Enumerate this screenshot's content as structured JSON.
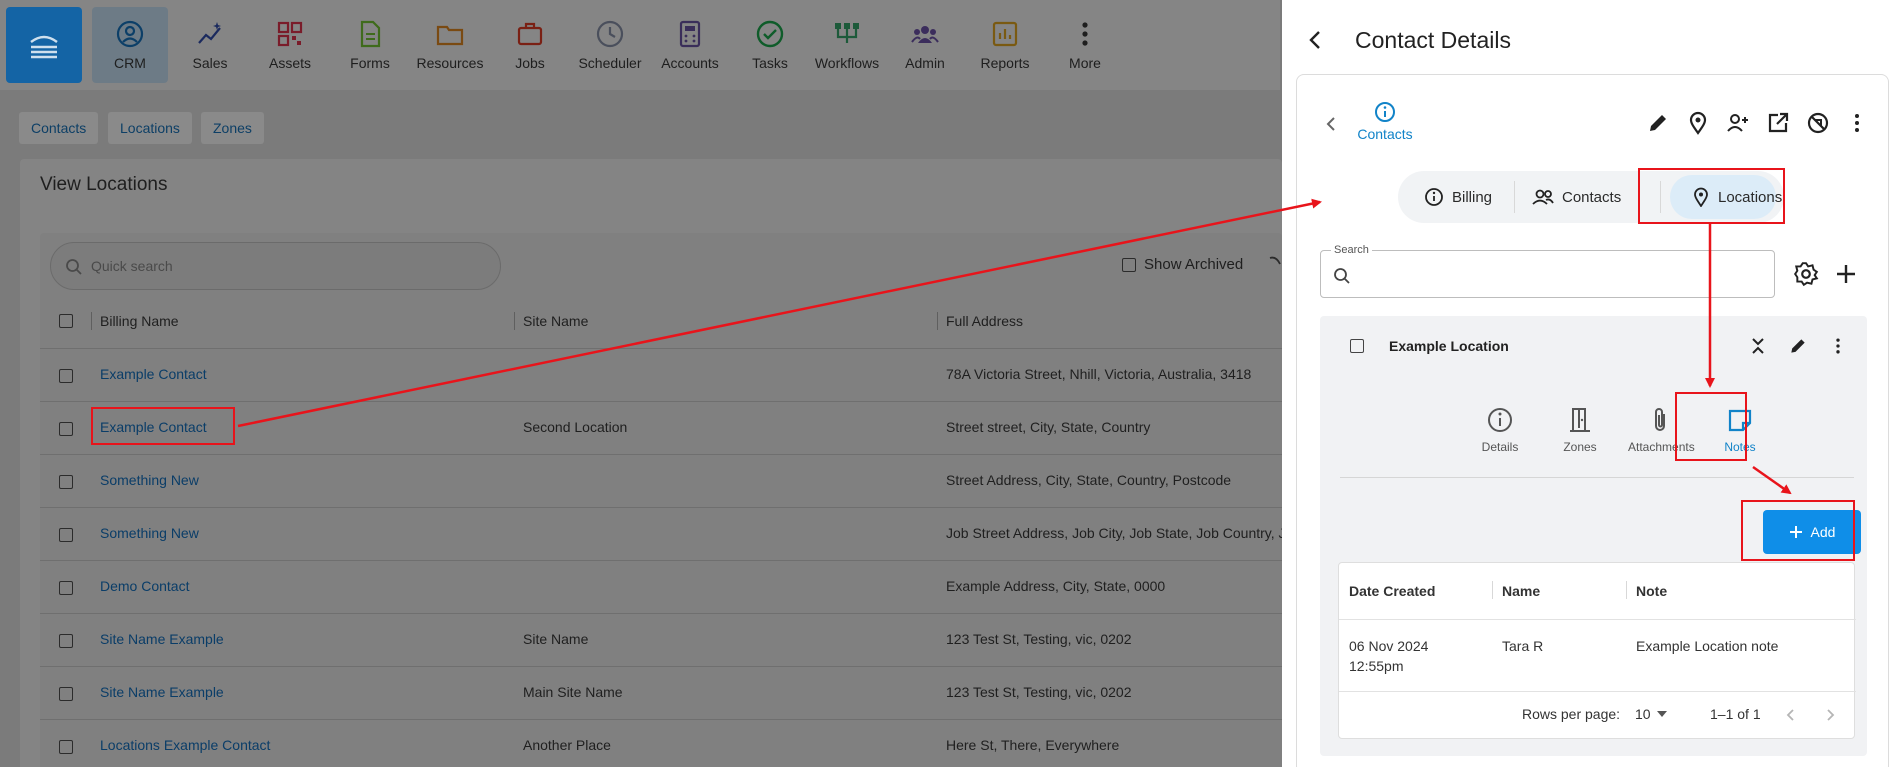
{
  "nav": {
    "items": [
      {
        "label": "CRM",
        "icon": "user-circle-icon"
      },
      {
        "label": "Sales",
        "icon": "sparkle-chart-icon"
      },
      {
        "label": "Assets",
        "icon": "qr-code-icon"
      },
      {
        "label": "Forms",
        "icon": "document-icon"
      },
      {
        "label": "Resources",
        "icon": "folder-icon"
      },
      {
        "label": "Jobs",
        "icon": "briefcase-icon"
      },
      {
        "label": "Scheduler",
        "icon": "clock-icon"
      },
      {
        "label": "Accounts",
        "icon": "calculator-icon"
      },
      {
        "label": "Tasks",
        "icon": "check-circle-icon"
      },
      {
        "label": "Workflows",
        "icon": "workflow-icon"
      },
      {
        "label": "Admin",
        "icon": "group-icon"
      },
      {
        "label": "Reports",
        "icon": "report-chart-icon"
      },
      {
        "label": "More",
        "icon": "more-vertical-icon"
      }
    ]
  },
  "subnav": {
    "tabs": [
      "Contacts",
      "Locations",
      "Zones"
    ]
  },
  "view": {
    "title": "View Locations",
    "search_placeholder": "Quick search",
    "show_archived": "Show Archived",
    "columns": [
      "Billing Name",
      "Site Name",
      "Full Address"
    ],
    "rows": [
      {
        "billing_name": "Example Contact",
        "site_name": "",
        "full_address": "78A Victoria Street, Nhill, Victoria, Australia, 3418"
      },
      {
        "billing_name": "Example Contact",
        "site_name": "Second Location",
        "full_address": "Street street, City, State, Country"
      },
      {
        "billing_name": "Something New",
        "site_name": "",
        "full_address": "Street Address, City, State, Country, Postcode"
      },
      {
        "billing_name": "Something New",
        "site_name": "",
        "full_address": "Job Street Address, Job City, Job State, Job Country, Jo"
      },
      {
        "billing_name": "Demo Contact",
        "site_name": "",
        "full_address": "Example Address, City, State, 0000"
      },
      {
        "billing_name": "Site Name Example",
        "site_name": "Site Name",
        "full_address": "123 Test St, Testing, vic, 0202"
      },
      {
        "billing_name": "Site Name Example",
        "site_name": "Main Site Name",
        "full_address": "123 Test St, Testing, vic, 0202"
      },
      {
        "billing_name": "Locations Example Contact",
        "site_name": "Another Place",
        "full_address": "Here St, There, Everywhere"
      }
    ]
  },
  "drawer": {
    "title": "Contact Details",
    "crumb": "Contacts",
    "segments": [
      "Billing",
      "Contacts",
      "Locations"
    ],
    "active_segment": "Locations",
    "search_label": "Search",
    "location": {
      "title": "Example Location",
      "tabs": [
        "Details",
        "Zones",
        "Attachments",
        "Notes"
      ],
      "active_tab": "Notes",
      "add_label": "Add",
      "notes": {
        "columns": [
          "Date Created",
          "Name",
          "Note"
        ],
        "rows": [
          {
            "date_line1": "06 Nov 2024",
            "date_line2": "12:55pm",
            "name": "Tara R",
            "note": "Example Location note"
          }
        ],
        "rows_per_page_label": "Rows per page:",
        "rows_per_page": "10",
        "range": "1–1 of 1"
      }
    }
  },
  "colors": {
    "accent": "#1183c8",
    "annotation": "#e8141b",
    "add_button": "#0f8ee8"
  }
}
